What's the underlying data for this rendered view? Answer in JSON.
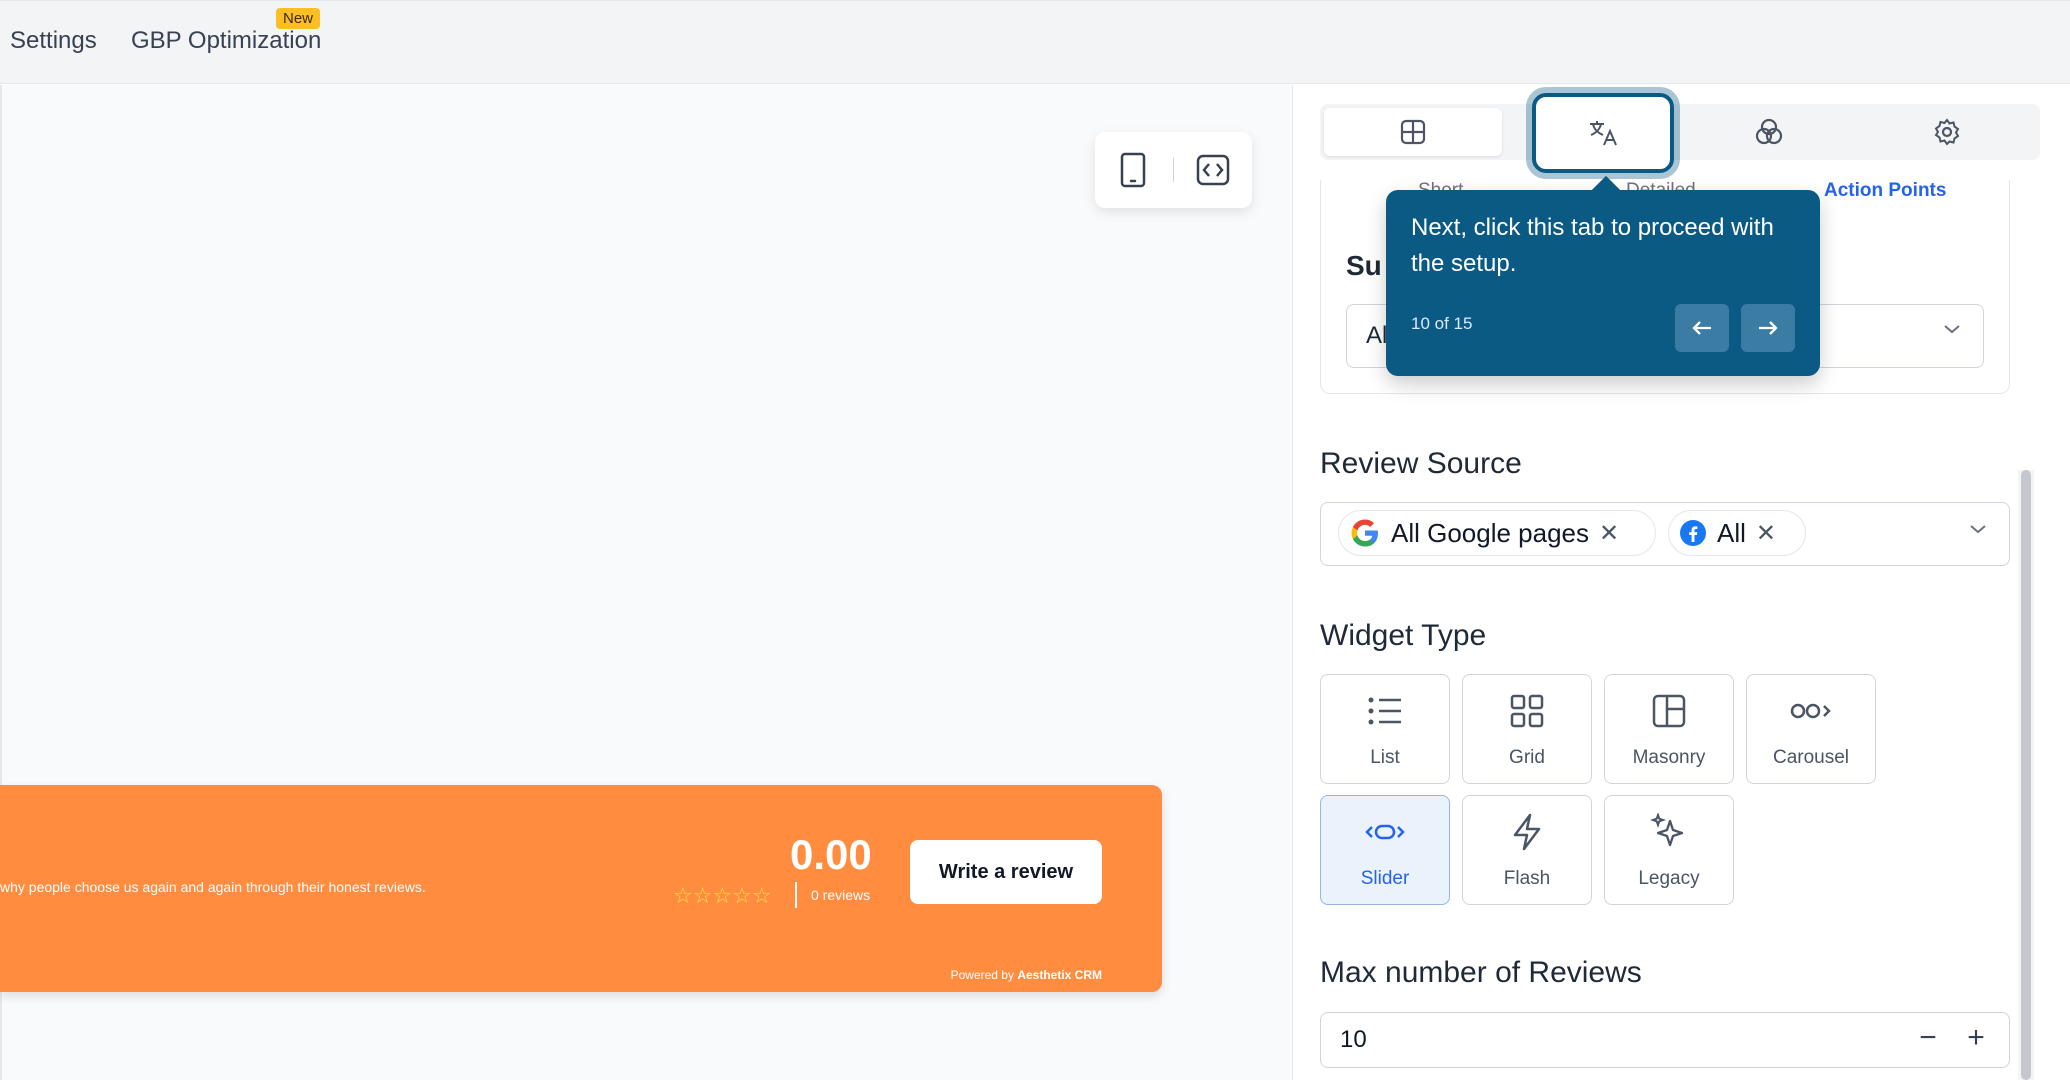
{
  "topbar": {
    "tabs": [
      {
        "label": "Settings"
      },
      {
        "label": "GBP Optimization"
      }
    ],
    "new_badge": "New"
  },
  "preview": {
    "banner": {
      "text": "why people choose us again and again through their honest reviews.",
      "rating": "0.00",
      "stars": "☆☆☆☆☆",
      "review_count": "0 reviews",
      "write_button": "Write a review",
      "powered_prefix": "Powered by",
      "powered_brand": "Aesthetix CRM",
      "color": "#ff8c3f"
    }
  },
  "panel": {
    "subtabs": [
      {
        "label": "Short"
      },
      {
        "label": "Detailed"
      },
      {
        "label": "Action Points"
      }
    ],
    "fragment": {
      "label": "Su",
      "select_value": "Al"
    },
    "review_source": {
      "label": "Review Source",
      "chips": [
        {
          "label": "All Google pages",
          "icon": "google-icon"
        },
        {
          "label": "All",
          "icon": "facebook-icon"
        }
      ]
    },
    "widget_type": {
      "label": "Widget Type",
      "options": [
        {
          "label": "List"
        },
        {
          "label": "Grid"
        },
        {
          "label": "Masonry"
        },
        {
          "label": "Carousel"
        },
        {
          "label": "Slider"
        },
        {
          "label": "Flash"
        },
        {
          "label": "Legacy"
        }
      ],
      "selected": "Slider"
    },
    "max_reviews": {
      "label": "Max number of Reviews",
      "value": "10",
      "minus": "−",
      "plus": "+"
    }
  },
  "tooltip": {
    "text": "Next, click this tab to proceed with the setup.",
    "counter": "10 of 15",
    "color": "#0b5a84"
  }
}
